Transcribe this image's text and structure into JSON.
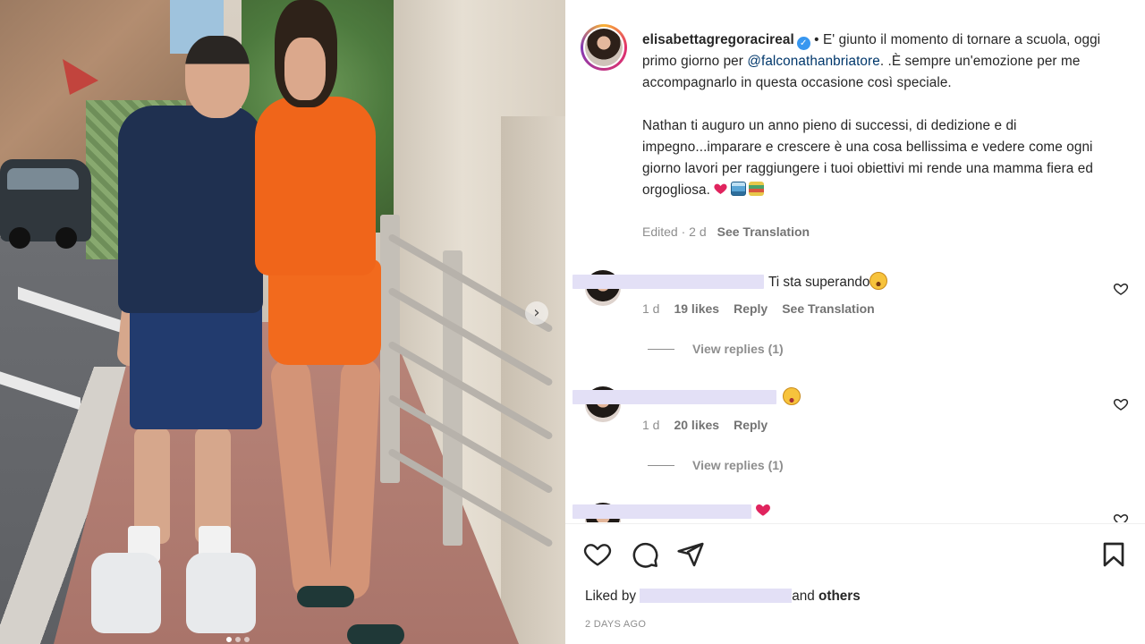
{
  "post": {
    "username": "elisabettagregoracireal",
    "caption_part1": " • E' giunto il momento di tornare a scuola, oggi primo giorno per ",
    "mention": "@falconathanbriatore",
    "caption_part2": ". .È sempre un'emozione per me accompagnarlo in questa occasione così speciale.",
    "caption_para2": "Nathan ti auguro un anno pieno di successi, di dedizione e di impegno...imparare e crescere è una cosa bellissima e vedere come ogni giorno lavori per raggiungere i tuoi obiettivi mi rende una mamma fiera ed orgogliosa.",
    "edited_label": "Edited · 2 d",
    "see_translation": "See Translation"
  },
  "comments": [
    {
      "text": "Ti sta superando",
      "emoji": "face-with-open-mouth",
      "time": "1 d",
      "likes": "19 likes",
      "reply": "Reply",
      "see_translation": "See Translation",
      "view_replies": "View replies (1)"
    },
    {
      "text": "",
      "emoji": "star-struck",
      "time": "1 d",
      "likes": "20 likes",
      "reply": "Reply",
      "view_replies": "View replies (1)"
    },
    {
      "text": "",
      "emoji": "red-heart"
    }
  ],
  "footer": {
    "liked_by_prefix": "Liked by ",
    "and_label": "and ",
    "others_label": "others",
    "timestamp": "2 DAYS AGO"
  },
  "icons": {
    "like": "heart-icon",
    "comment": "comment-icon",
    "share": "send-icon",
    "save": "bookmark-icon",
    "next": "chevron-right-icon"
  },
  "colors": {
    "verified": "#3897f0",
    "mention": "#00376b",
    "heart": "#e0245e",
    "muted": "#8e8e8e"
  }
}
